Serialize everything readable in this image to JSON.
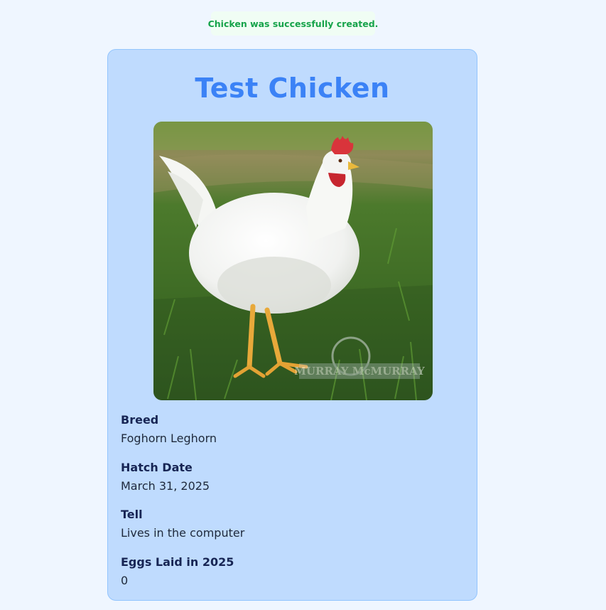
{
  "notice": {
    "text": "Chicken was successfully created."
  },
  "chicken": {
    "name": "Test Chicken",
    "photo": {
      "alt": "White Leghorn chicken standing on grass",
      "watermark": "MURRAY McMURRAY"
    },
    "fields": [
      {
        "label": "Breed",
        "value": "Foghorn Leghorn"
      },
      {
        "label": "Hatch Date",
        "value": "March 31, 2025"
      },
      {
        "label": "Tell",
        "value": "Lives in the computer"
      },
      {
        "label": "Eggs Laid in 2025",
        "value": "0"
      }
    ]
  },
  "colors": {
    "page_background": "#eff6ff",
    "card_background": "#bfdbfe",
    "card_border": "#93c5fd",
    "title": "#3b82f6",
    "notice_text": "#16a34a",
    "notice_background": "#f0fdf4",
    "label_text": "#172554"
  }
}
